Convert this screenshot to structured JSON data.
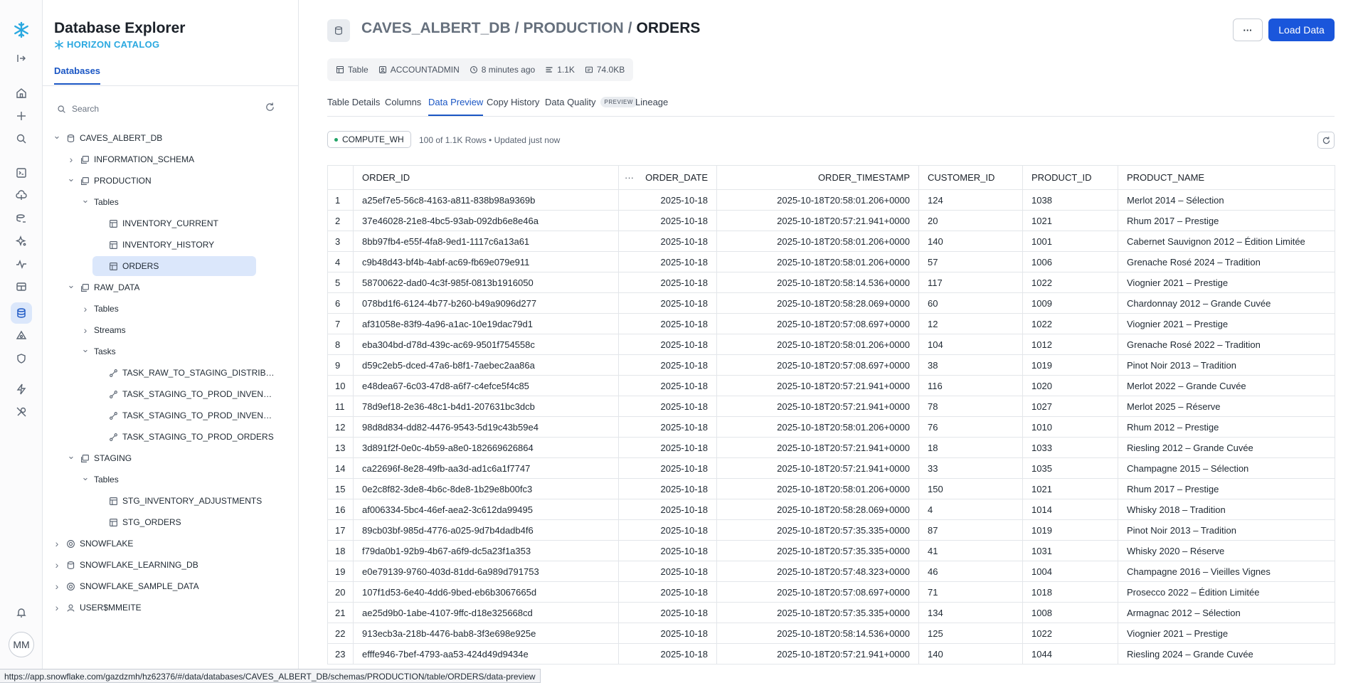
{
  "rail": {
    "avatar_initials": "MM"
  },
  "explorer": {
    "title": "Database Explorer",
    "subtitle": "HORIZON CATALOG",
    "tab": "Databases",
    "search_placeholder": "Search",
    "tree": [
      {
        "label": "CAVES_ALBERT_DB",
        "chev": "open",
        "icon": "database-icon",
        "level": 0
      },
      {
        "label": "INFORMATION_SCHEMA",
        "chev": "closed",
        "icon": "schema-icon",
        "level": 1
      },
      {
        "label": "PRODUCTION",
        "chev": "open",
        "icon": "schema-icon",
        "level": 1
      },
      {
        "label": "Tables",
        "chev": "open",
        "icon": "",
        "level": 2
      },
      {
        "label": "INVENTORY_CURRENT",
        "chev": "",
        "icon": "table-icon",
        "level": 3
      },
      {
        "label": "INVENTORY_HISTORY",
        "chev": "",
        "icon": "table-icon",
        "level": 3
      },
      {
        "label": "ORDERS",
        "chev": "",
        "icon": "table-icon",
        "level": 3,
        "selected": true
      },
      {
        "label": "RAW_DATA",
        "chev": "open",
        "icon": "schema-icon",
        "level": 1
      },
      {
        "label": "Tables",
        "chev": "closed",
        "icon": "",
        "level": 2
      },
      {
        "label": "Streams",
        "chev": "closed",
        "icon": "",
        "level": 2
      },
      {
        "label": "Tasks",
        "chev": "open",
        "icon": "",
        "level": 2
      },
      {
        "label": "TASK_RAW_TO_STAGING_DISTRIBU...",
        "chev": "",
        "icon": "task-icon",
        "level": 3
      },
      {
        "label": "TASK_STAGING_TO_PROD_INVENTO...",
        "chev": "",
        "icon": "task-icon",
        "level": 3
      },
      {
        "label": "TASK_STAGING_TO_PROD_INVENTO...",
        "chev": "",
        "icon": "task-icon",
        "level": 3
      },
      {
        "label": "TASK_STAGING_TO_PROD_ORDERS",
        "chev": "",
        "icon": "task-icon",
        "level": 3
      },
      {
        "label": "STAGING",
        "chev": "open",
        "icon": "schema-icon",
        "level": 1
      },
      {
        "label": "Tables",
        "chev": "open",
        "icon": "",
        "level": 2
      },
      {
        "label": "STG_INVENTORY_ADJUSTMENTS",
        "chev": "",
        "icon": "table-icon",
        "level": 3
      },
      {
        "label": "STG_ORDERS",
        "chev": "",
        "icon": "table-icon",
        "level": 3
      },
      {
        "label": "SNOWFLAKE",
        "chev": "closed",
        "icon": "shared-db-icon",
        "level": 0
      },
      {
        "label": "SNOWFLAKE_LEARNING_DB",
        "chev": "closed",
        "icon": "database-icon",
        "level": 0
      },
      {
        "label": "SNOWFLAKE_SAMPLE_DATA",
        "chev": "closed",
        "icon": "shared-db-icon",
        "level": 0
      },
      {
        "label": "USER$MMEITE",
        "chev": "closed",
        "icon": "user-icon",
        "level": 0
      }
    ]
  },
  "header": {
    "db": "CAVES_ALBERT_DB",
    "sep1": "/",
    "schema": "PRODUCTION",
    "sep2": "/",
    "table": "ORDERS",
    "more_label": "···",
    "load_label": "Load Data"
  },
  "meta": {
    "type": "Table",
    "owner": "ACCOUNTADMIN",
    "updated": "8 minutes ago",
    "rows": "1.1K",
    "size": "74.0KB"
  },
  "tabs": [
    {
      "label": "Table Details"
    },
    {
      "label": "Columns"
    },
    {
      "label": "Data Preview",
      "active": true
    },
    {
      "label": "Copy History"
    },
    {
      "label": "Data Quality",
      "badge": "PREVIEW"
    },
    {
      "label": "Lineage"
    }
  ],
  "preview": {
    "warehouse": "COMPUTE_WH",
    "rows_info": "100 of 1.1K Rows • Updated just now",
    "columns": [
      "ORDER_ID",
      "ORDER_DATE",
      "ORDER_TIMESTAMP",
      "CUSTOMER_ID",
      "PRODUCT_ID",
      "PRODUCT_NAME"
    ],
    "header_menu": "···",
    "rows": [
      [
        "1",
        "a25ef7e5-56c8-4163-a811-838b98a9369b",
        "2025-10-18",
        "2025-10-18T20:58:01.206+0000",
        "124",
        "1038",
        "Merlot 2014 – Sélection"
      ],
      [
        "2",
        "37e46028-21e8-4bc5-93ab-092db6e8e46a",
        "2025-10-18",
        "2025-10-18T20:57:21.941+0000",
        "20",
        "1021",
        "Rhum 2017 – Prestige"
      ],
      [
        "3",
        "8bb97fb4-e55f-4fa8-9ed1-1117c6a13a61",
        "2025-10-18",
        "2025-10-18T20:58:01.206+0000",
        "140",
        "1001",
        "Cabernet Sauvignon 2012 – Édition Limitée"
      ],
      [
        "4",
        "c9b48d43-bf4b-4abf-ac69-fb69e079e911",
        "2025-10-18",
        "2025-10-18T20:58:01.206+0000",
        "57",
        "1006",
        "Grenache Rosé 2024 – Tradition"
      ],
      [
        "5",
        "58700622-dad0-4c3f-985f-0813b1916050",
        "2025-10-18",
        "2025-10-18T20:58:14.536+0000",
        "117",
        "1022",
        "Viognier 2021 – Prestige"
      ],
      [
        "6",
        "078bd1f6-6124-4b77-b260-b49a9096d277",
        "2025-10-18",
        "2025-10-18T20:58:28.069+0000",
        "60",
        "1009",
        "Chardonnay 2012 – Grande Cuvée"
      ],
      [
        "7",
        "af31058e-83f9-4a96-a1ac-10e19dac79d1",
        "2025-10-18",
        "2025-10-18T20:57:08.697+0000",
        "12",
        "1022",
        "Viognier 2021 – Prestige"
      ],
      [
        "8",
        "eba304bd-d78d-439c-ac69-9501f754558c",
        "2025-10-18",
        "2025-10-18T20:58:01.206+0000",
        "104",
        "1012",
        "Grenache Rosé 2022 – Tradition"
      ],
      [
        "9",
        "d59c2eb5-dced-47a6-b8f1-7aebec2aa86a",
        "2025-10-18",
        "2025-10-18T20:57:08.697+0000",
        "38",
        "1019",
        "Pinot Noir 2013 – Tradition"
      ],
      [
        "10",
        "e48dea67-6c03-47d8-a6f7-c4efce5f4c85",
        "2025-10-18",
        "2025-10-18T20:57:21.941+0000",
        "116",
        "1020",
        "Merlot 2022 – Grande Cuvée"
      ],
      [
        "11",
        "78d9ef18-2e36-48c1-b4d1-207631bc3dcb",
        "2025-10-18",
        "2025-10-18T20:57:21.941+0000",
        "78",
        "1027",
        "Merlot 2025 – Réserve"
      ],
      [
        "12",
        "98d8d834-dd82-4476-9543-5d19c43b59e4",
        "2025-10-18",
        "2025-10-18T20:58:01.206+0000",
        "76",
        "1010",
        "Rhum 2012 – Prestige"
      ],
      [
        "13",
        "3d891f2f-0e0c-4b59-a8e0-182669626864",
        "2025-10-18",
        "2025-10-18T20:57:21.941+0000",
        "18",
        "1033",
        "Riesling 2012 – Grande Cuvée"
      ],
      [
        "14",
        "ca22696f-8e28-49fb-aa3d-ad1c6a1f7747",
        "2025-10-18",
        "2025-10-18T20:57:21.941+0000",
        "33",
        "1035",
        "Champagne 2015 – Sélection"
      ],
      [
        "15",
        "0e2c8f82-3de8-4b6c-8de8-1b29e8b00fc3",
        "2025-10-18",
        "2025-10-18T20:58:01.206+0000",
        "150",
        "1021",
        "Rhum 2017 – Prestige"
      ],
      [
        "16",
        "af006334-5bc4-46ef-aea2-3c612da99495",
        "2025-10-18",
        "2025-10-18T20:58:28.069+0000",
        "4",
        "1014",
        "Whisky 2018 – Tradition"
      ],
      [
        "17",
        "89cb03bf-985d-4776-a025-9d7b4dadb4f6",
        "2025-10-18",
        "2025-10-18T20:57:35.335+0000",
        "87",
        "1019",
        "Pinot Noir 2013 – Tradition"
      ],
      [
        "18",
        "f79da0b1-92b9-4b67-a6f9-dc5a23f1a353",
        "2025-10-18",
        "2025-10-18T20:57:35.335+0000",
        "41",
        "1031",
        "Whisky 2020 – Réserve"
      ],
      [
        "19",
        "e0e79139-9760-403d-81dd-6a989d791753",
        "2025-10-18",
        "2025-10-18T20:57:48.323+0000",
        "46",
        "1004",
        "Champagne 2016 – Vieilles Vignes"
      ],
      [
        "20",
        "107f1d53-6e40-4dd6-9bed-eb6b3067665d",
        "2025-10-18",
        "2025-10-18T20:57:08.697+0000",
        "71",
        "1018",
        "Prosecco 2022 – Édition Limitée"
      ],
      [
        "21",
        "ae25d9b0-1abe-4107-9ffc-d18e325668cd",
        "2025-10-18",
        "2025-10-18T20:57:35.335+0000",
        "134",
        "1008",
        "Armagnac 2012 – Sélection"
      ],
      [
        "22",
        "913ecb3a-218b-4476-bab8-3f3e698e925e",
        "2025-10-18",
        "2025-10-18T20:58:14.536+0000",
        "125",
        "1022",
        "Viognier 2021 – Prestige"
      ],
      [
        "23",
        "efffe946-7bef-4793-aa53-424d49d9434e",
        "2025-10-18",
        "2025-10-18T20:57:21.941+0000",
        "140",
        "1044",
        "Riesling 2024 – Grande Cuvée"
      ]
    ]
  },
  "statusbar": {
    "url": "https://app.snowflake.com/gazdzmh/hz62376/#/data/databases/CAVES_ALBERT_DB/schemas/PRODUCTION/table/ORDERS/data-preview"
  },
  "colors": {
    "accent": "#1a56c4",
    "primary_button": "#1a56db",
    "brand": "#29a8e0",
    "selected_bg": "#dbe7fb"
  }
}
